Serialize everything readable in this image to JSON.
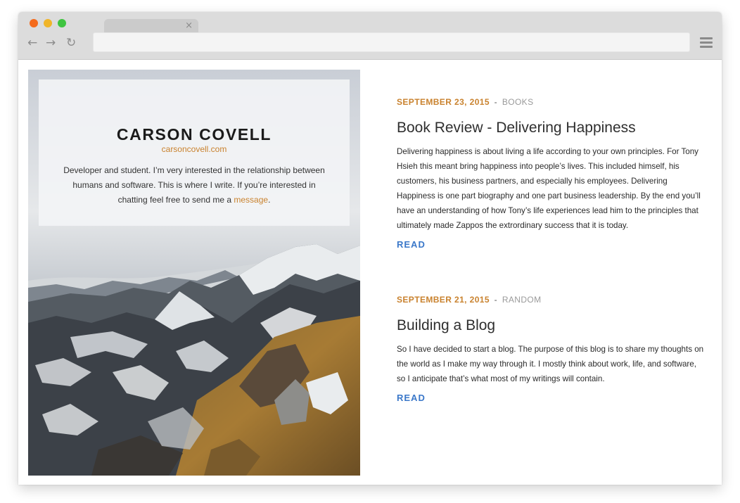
{
  "browser": {
    "traffic_lights": {
      "close": "#f46b1c",
      "minimize": "#f0b529",
      "zoom": "#3fc440"
    },
    "tab": {
      "close_glyph": "×"
    },
    "nav": {
      "back_glyph": "←",
      "forward_glyph": "→",
      "reload_glyph": "↻"
    },
    "url": ""
  },
  "sidebar": {
    "site_name": "CARSON COVELL",
    "site_url": "carsoncovell.com",
    "bio_text": "Developer and student. I’m very interested in the relationship between humans and software. This is where I write. If you’re interested in chatting feel free to send me a ",
    "bio_link": "message",
    "bio_end": "."
  },
  "posts": [
    {
      "date": "SEPTEMBER 23, 2015",
      "separator": "-",
      "category": "BOOKS",
      "title": "Book Review - Delivering Happiness",
      "excerpt": "Delivering happiness is about living a life according to your own principles. For Tony Hsieh this meant bring happiness into people’s lives. This included himself, his customers, his business partners, and especially his employees. Delivering Happiness is one part biography and one part business leadership. By the end you’ll have an understanding of how Tony’s life experiences lead him to the principles that ultimately made Zappos the extrordinary success that it is today.",
      "read_label": "READ"
    },
    {
      "date": "SEPTEMBER 21, 2015",
      "separator": "-",
      "category": "RANDOM",
      "title": "Building a Blog",
      "excerpt": "So I have decided to start a blog. The purpose of this blog is to share my thoughts on the world as I make my way through it. I mostly think about work, life, and software, so I anticipate that’s what most of my writings will contain.",
      "read_label": "READ"
    }
  ],
  "colors": {
    "accent_orange": "#c9822e",
    "link_blue": "#3b78c9",
    "meta_gray": "#9a9a9a"
  }
}
